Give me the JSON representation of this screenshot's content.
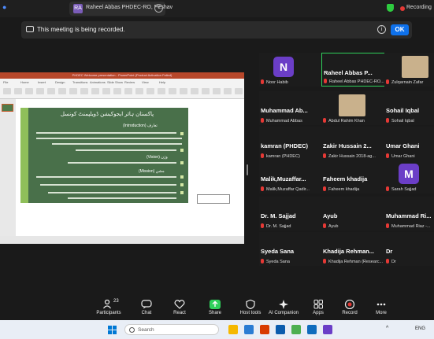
{
  "topbar": {
    "tab_avatar": "RA",
    "tab_label": "Raheel Abbas PHDEC-RO, Peshav",
    "recording_label": "Recording"
  },
  "banner": {
    "text": "This meeting is being recorded.",
    "ok": "OK"
  },
  "shared_screen": {
    "ppt_title": "PHDEC Welcome presentation - PowerPoint (Product Activation Failed)",
    "ribbon_tabs": [
      "File",
      "Home",
      "Insert",
      "Design",
      "Transitions",
      "Animations",
      "Slide Show",
      "Review",
      "View",
      "Help"
    ],
    "slide_title": "پاکستان ہائر ایجوکیشن ڈویلپمنٹ کونسل",
    "slide_headings": [
      "تعارف (Introduction)",
      "وژن (Vision)",
      "مشن (Mission)"
    ]
  },
  "gallery": [
    {
      "name": "N",
      "footer": "Noor Habib",
      "type": "avatar"
    },
    {
      "name": "Raheel Abbas P...",
      "footer": "Raheel Abbas PHDEC-RO...",
      "type": "name",
      "active": true
    },
    {
      "name": "",
      "footer": "Zulqarnain Zafar",
      "type": "video"
    },
    {
      "name": "Muhammad Ab...",
      "footer": "Muhammad Abbas",
      "type": "name"
    },
    {
      "name": "",
      "footer": "Abdul Rahim Khan",
      "type": "video"
    },
    {
      "name": "Sohail Iqbal",
      "footer": "Sohail Iqbal",
      "type": "name"
    },
    {
      "name": "kamran (PHDEC)",
      "footer": "kamran (PHDEC)",
      "type": "name"
    },
    {
      "name": "Zakir Hussain 2...",
      "footer": "Zakir Hussain 2018-ag...",
      "type": "name"
    },
    {
      "name": "Umar Ghani",
      "footer": "Umar Ghani",
      "type": "name"
    },
    {
      "name": "Malik,Muzaffar...",
      "footer": "Malik,Muzaffar Qadir...",
      "type": "name"
    },
    {
      "name": "Faheem khadija",
      "footer": "Faheem khadija",
      "type": "name"
    },
    {
      "name": "M",
      "footer": "Sarah Sajjad",
      "type": "avatar"
    },
    {
      "name": "Dr. M. Sajjad",
      "footer": "Dr. M. Sajjad",
      "type": "name"
    },
    {
      "name": "Ayub",
      "footer": "Ayub",
      "type": "name"
    },
    {
      "name": "Muhammad Ri...",
      "footer": "Muhammad Riaz -...",
      "type": "name"
    },
    {
      "name": "Syeda Sana",
      "footer": "Syeda Sana",
      "type": "name"
    },
    {
      "name": "Khadija Rehman...",
      "footer": "Khadija Rehman (Researc...",
      "type": "name"
    },
    {
      "name": "Dr",
      "footer": "Dr",
      "type": "name"
    }
  ],
  "toolbar": {
    "participants_count": "23",
    "items": [
      "Participants",
      "Chat",
      "React",
      "Share",
      "Host tools",
      "AI Companion",
      "Apps",
      "Record",
      "More"
    ]
  },
  "taskbar": {
    "search_placeholder": "Search",
    "lang": "ENG"
  },
  "colors": {
    "accent_blue": "#0e71eb",
    "active_speaker": "#2fd05a",
    "recording_red": "#e53935",
    "slide_green": "#49704a"
  }
}
